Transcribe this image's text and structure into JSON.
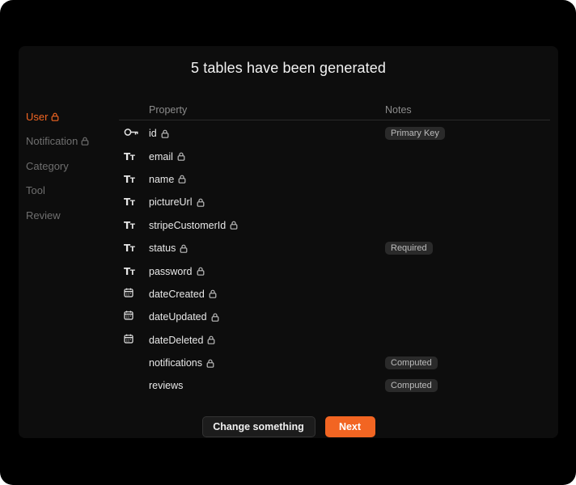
{
  "title": "5 tables have been generated",
  "colors": {
    "accent": "#f26522",
    "background": "#000000",
    "panel": "#0d0d0d"
  },
  "sidebar": {
    "items": [
      {
        "label": "User",
        "locked": true,
        "active": true
      },
      {
        "label": "Notification",
        "locked": true,
        "active": false
      },
      {
        "label": "Category",
        "locked": false,
        "active": false
      },
      {
        "label": "Tool",
        "locked": false,
        "active": false
      },
      {
        "label": "Review",
        "locked": false,
        "active": false
      }
    ]
  },
  "table": {
    "headers": {
      "property": "Property",
      "notes": "Notes"
    },
    "rows": [
      {
        "icon": "key-icon",
        "name": "id",
        "locked": true,
        "note": "Primary Key"
      },
      {
        "icon": "text-type-icon",
        "name": "email",
        "locked": true,
        "note": ""
      },
      {
        "icon": "text-type-icon",
        "name": "name",
        "locked": true,
        "note": ""
      },
      {
        "icon": "text-type-icon",
        "name": "pictureUrl",
        "locked": true,
        "note": ""
      },
      {
        "icon": "text-type-icon",
        "name": "stripeCustomerId",
        "locked": true,
        "note": ""
      },
      {
        "icon": "text-type-icon",
        "name": "status",
        "locked": true,
        "note": "Required"
      },
      {
        "icon": "text-type-icon",
        "name": "password",
        "locked": true,
        "note": ""
      },
      {
        "icon": "calendar-icon",
        "name": "dateCreated",
        "locked": true,
        "note": ""
      },
      {
        "icon": "calendar-icon",
        "name": "dateUpdated",
        "locked": true,
        "note": ""
      },
      {
        "icon": "calendar-icon",
        "name": "dateDeleted",
        "locked": true,
        "note": ""
      },
      {
        "icon": "",
        "name": "notifications",
        "locked": true,
        "note": "Computed"
      },
      {
        "icon": "",
        "name": "reviews",
        "locked": false,
        "note": "Computed"
      }
    ]
  },
  "buttons": {
    "change": "Change something",
    "next": "Next"
  },
  "icons": {
    "type_glyph": "TT"
  }
}
